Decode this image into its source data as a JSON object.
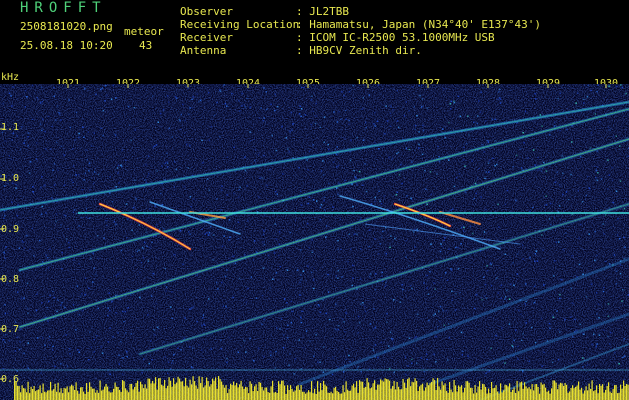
{
  "header": {
    "logo": "HROFFT",
    "filename": "2508181020.png",
    "mode_label": "meteor",
    "datetime": "25.08.18 10:20",
    "count": "43",
    "fields": [
      {
        "label": "Observer",
        "value": ": JL2TBB"
      },
      {
        "label": "Receiving Location",
        "value": ": Hamamatsu, Japan (N34°40' E137°43')"
      },
      {
        "label": "Receiver",
        "value": ": ICOM IC-R2500 53.1000MHz USB"
      },
      {
        "label": "Antenna",
        "value": ": HB9CV Zenith dir."
      }
    ]
  },
  "axis": {
    "y_unit": "kHz",
    "x_ticks": [
      "1021",
      "1022",
      "1023",
      "1024",
      "1025",
      "1026",
      "1027",
      "1028",
      "1029",
      "1030"
    ],
    "y_ticks": [
      "1.1",
      "1.0",
      "0.9",
      "0.8",
      "0.7",
      "0.6"
    ]
  },
  "colors": {
    "text": "#e8e850",
    "logo": "#4fd27a",
    "background": "#000014",
    "carrier_line": "#40e0e0"
  }
}
